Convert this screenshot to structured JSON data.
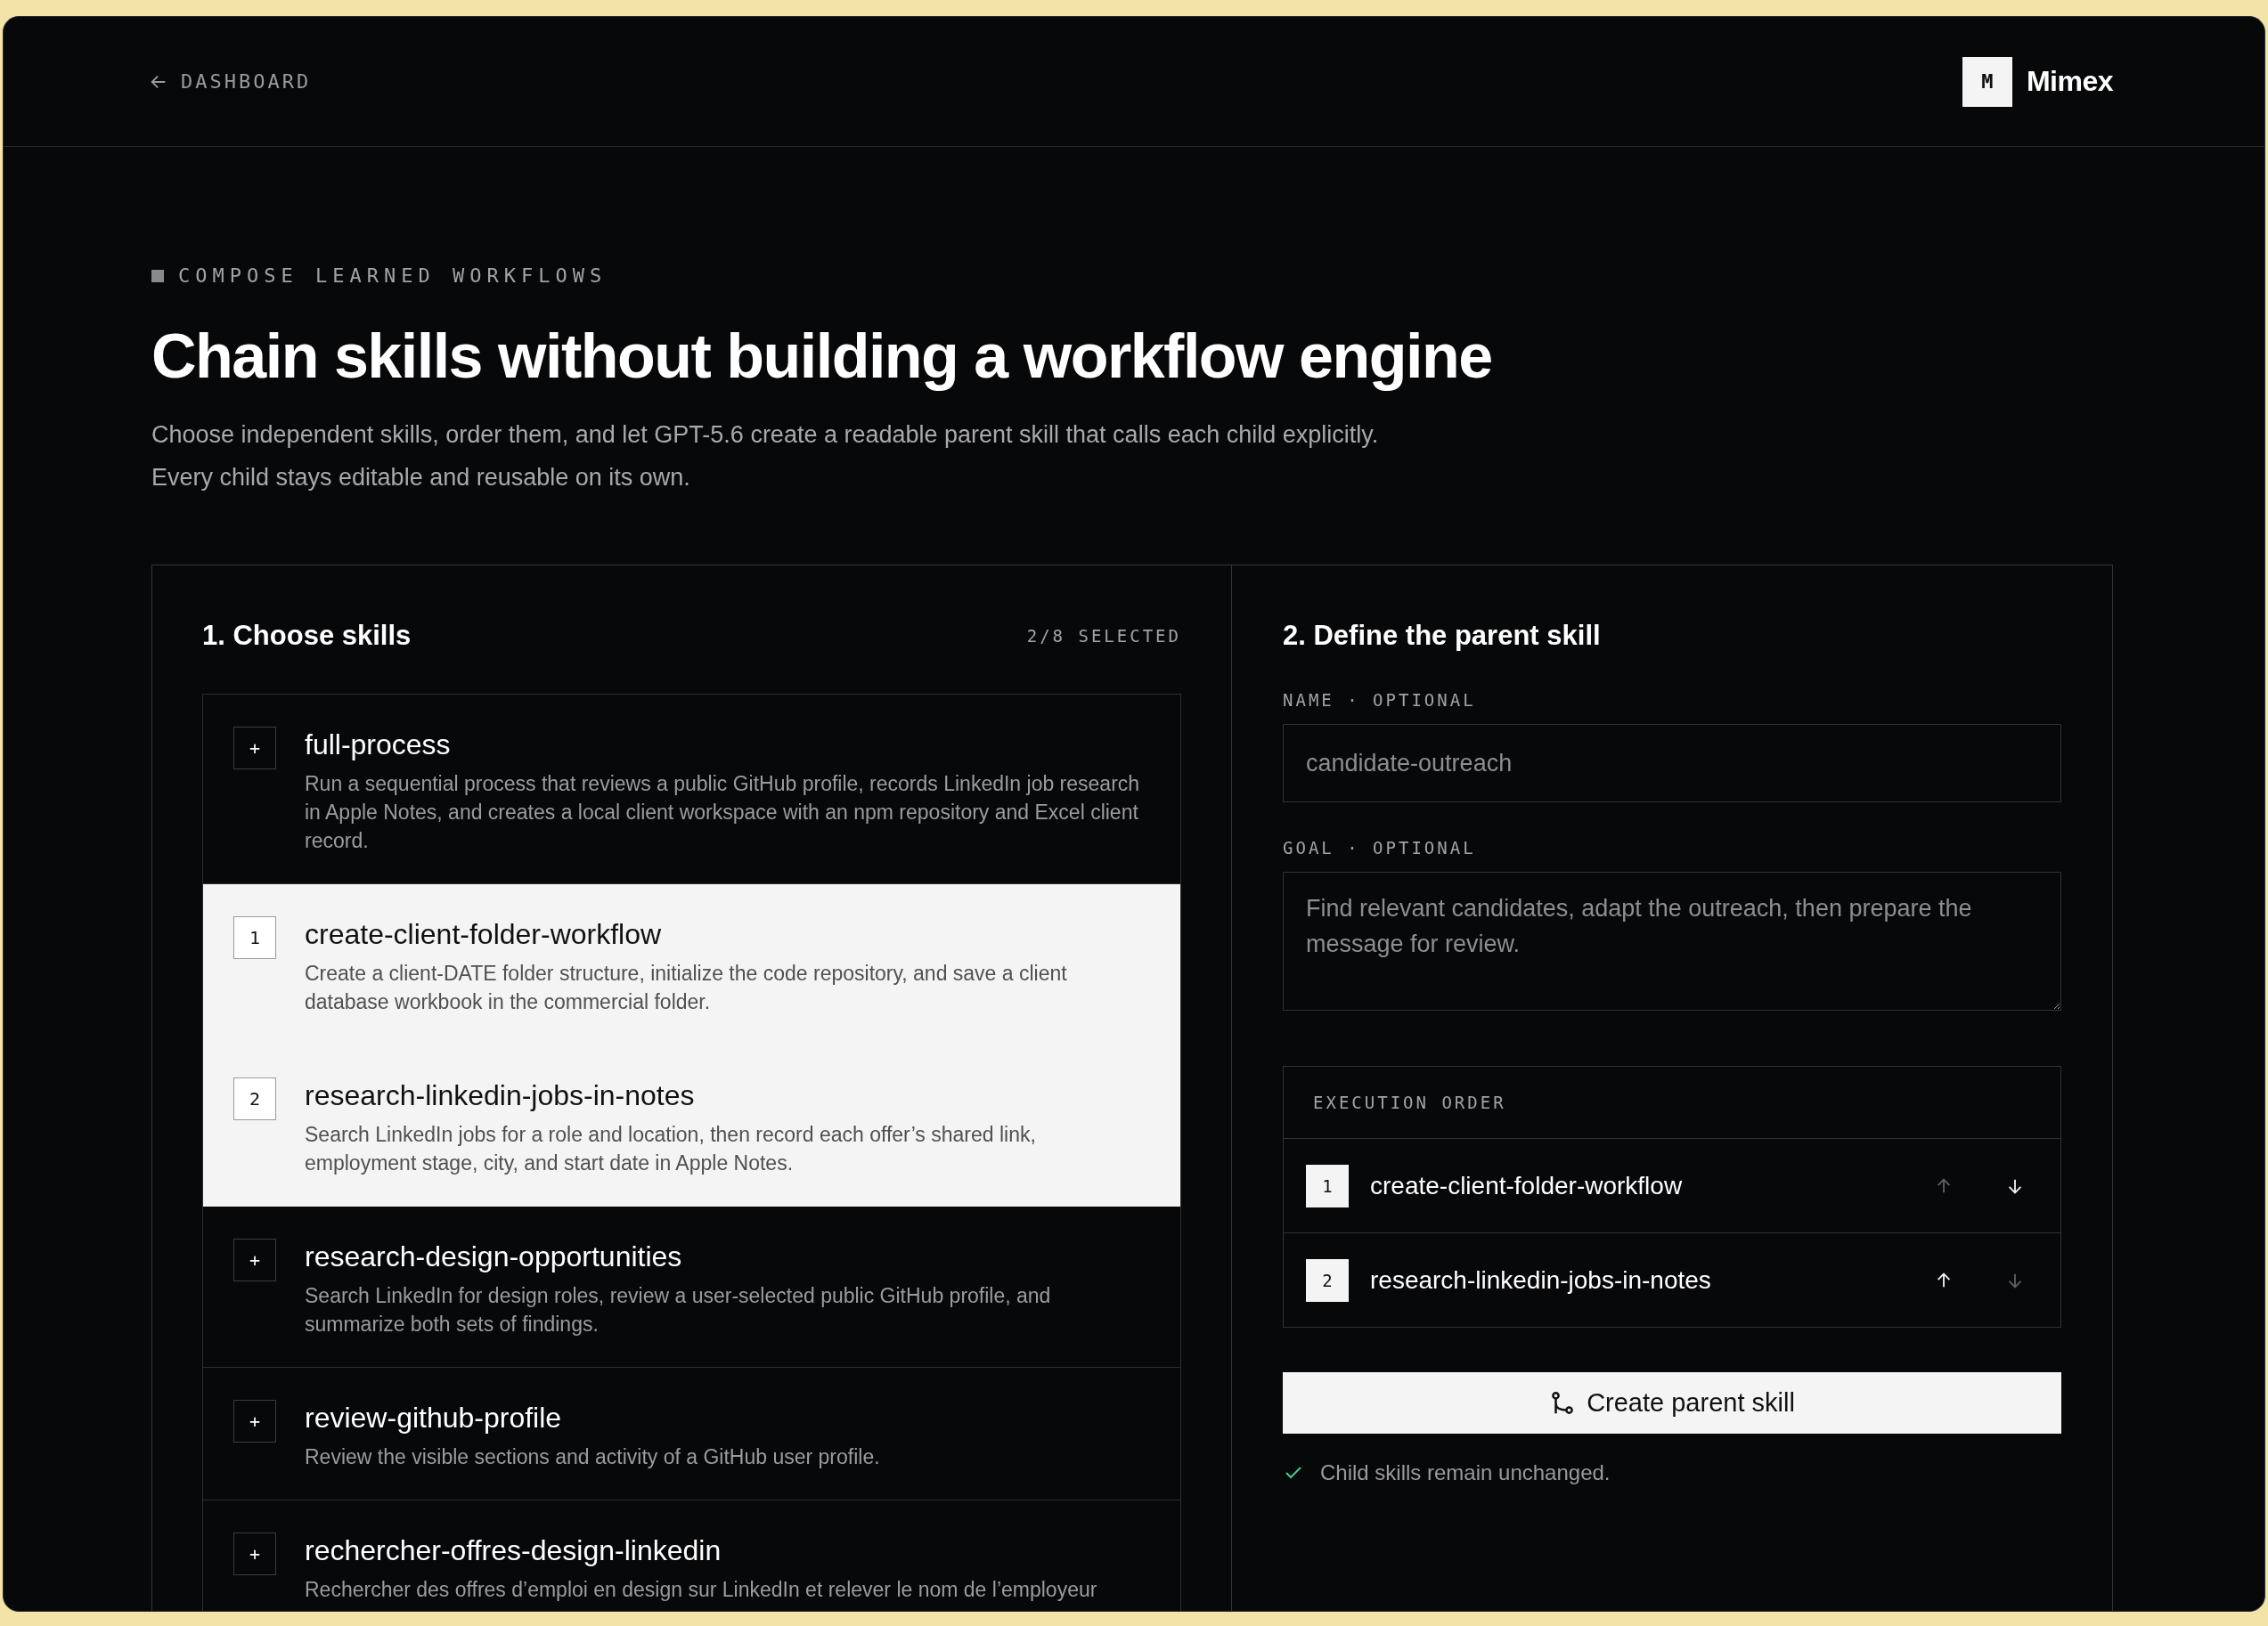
{
  "nav": {
    "back_link": "DASHBOARD"
  },
  "brand": {
    "mark": "M",
    "name": "Mimex"
  },
  "eyebrow": "COMPOSE LEARNED WORKFLOWS",
  "title": "Chain skills without building a workflow engine",
  "subtitle": "Choose independent skills, order them, and let GPT-5.6 create a readable parent skill that calls each child explicitly. Every child stays editable and reusable on its own.",
  "skills_panel": {
    "heading": "1. Choose skills",
    "count": "2/8 SELECTED",
    "skills": [
      {
        "name": "full-process",
        "description": "Run a sequential process that reviews a public GitHub profile, records LinkedIn job research in Apple Notes, and creates a local client workspace with an npm repository and Excel client record.",
        "marker": "+",
        "selected": false
      },
      {
        "name": "create-client-folder-workflow",
        "description": "Create a client-DATE folder structure, initialize the code repository, and save a client database workbook in the commercial folder.",
        "marker": "1",
        "selected": true
      },
      {
        "name": "research-linkedin-jobs-in-notes",
        "description": "Search LinkedIn jobs for a role and location, then record each offer’s shared link, employment stage, city, and start date in Apple Notes.",
        "marker": "2",
        "selected": true
      },
      {
        "name": "research-design-opportunities",
        "description": "Search LinkedIn for design roles, review a user-selected public GitHub profile, and summarize both sets of findings.",
        "marker": "+",
        "selected": false
      },
      {
        "name": "review-github-profile",
        "description": "Review the visible sections and activity of a GitHub user profile.",
        "marker": "+",
        "selected": false
      },
      {
        "name": "rechercher-offres-design-linkedin",
        "description": "Rechercher des offres d’emploi en design sur LinkedIn et relever le nom de l’employeur",
        "marker": "+",
        "selected": false
      }
    ]
  },
  "parent_panel": {
    "heading": "2. Define the parent skill",
    "name_field": {
      "label": "NAME · OPTIONAL",
      "placeholder": "candidate-outreach"
    },
    "goal_field": {
      "label": "GOAL · OPTIONAL",
      "placeholder": "Find relevant candidates, adapt the outreach, then prepare the message for review."
    },
    "execution_order": {
      "heading": "EXECUTION ORDER",
      "steps": [
        {
          "number": "1",
          "name": "create-client-folder-workflow",
          "up_disabled": true,
          "down_disabled": false
        },
        {
          "number": "2",
          "name": "research-linkedin-jobs-in-notes",
          "up_disabled": false,
          "down_disabled": true
        }
      ]
    },
    "create_button": "Create parent skill",
    "note": "Child skills remain unchanged."
  }
}
